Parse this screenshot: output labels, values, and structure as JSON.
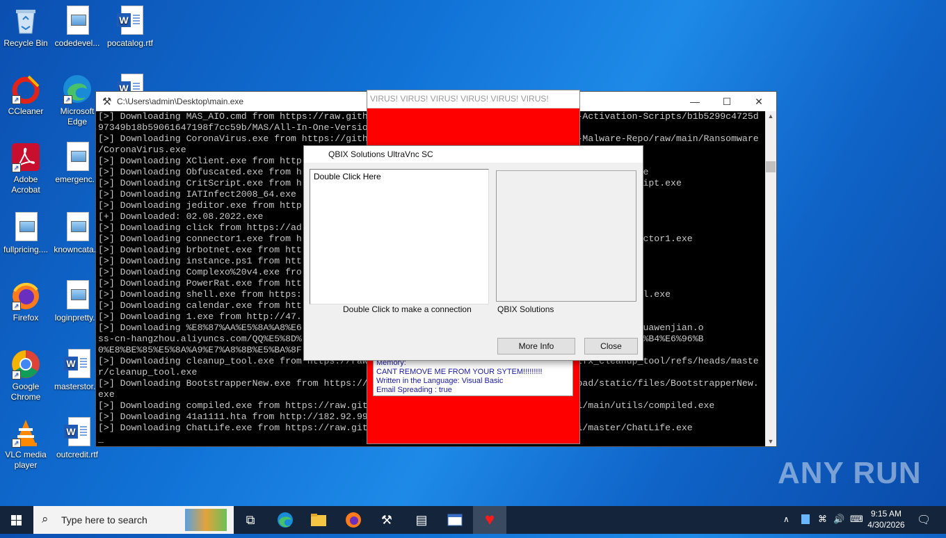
{
  "desktop": {
    "icons": [
      {
        "label": "Recycle Bin",
        "icon": "recycle-bin-icon"
      },
      {
        "label": "codedevel...",
        "icon": "image-file-icon"
      },
      {
        "label": "pocatalog.rtf",
        "icon": "word-doc-icon"
      },
      {
        "label": "CCleaner",
        "icon": "ccleaner-icon"
      },
      {
        "label": "Microsoft Edge",
        "icon": "edge-icon"
      },
      {
        "label": "Adobe Acrobat",
        "icon": "acrobat-icon"
      },
      {
        "label": "emergenc...",
        "icon": "image-file-icon"
      },
      {
        "label": "fullpricing....",
        "icon": "image-file-icon"
      },
      {
        "label": "knowncata...",
        "icon": "image-file-icon"
      },
      {
        "label": "Firefox",
        "icon": "firefox-icon"
      },
      {
        "label": "loginpretty...",
        "icon": "image-file-icon"
      },
      {
        "label": "Google Chrome",
        "icon": "chrome-icon"
      },
      {
        "label": "masterstor...",
        "icon": "word-doc-icon"
      },
      {
        "label": "VLC media player",
        "icon": "vlc-icon"
      },
      {
        "label": "outcredit.rtf",
        "icon": "word-doc-icon"
      }
    ]
  },
  "console": {
    "title": "C:\\Users\\admin\\Desktop\\main.exe",
    "lines": [
      "[>] Downloading MAS_AIO.cmd from https://raw.gith                                      -Activation-Scripts/b1b5299c4725d",
      "97349b18b59061647198f7cc59b/MAS/All-In-One-Versio",
      "[>] Downloading CoronaVirus.exe from https://gith                                      -Malware-Repo/raw/main/Ransomware",
      "/CoronaVirus.exe",
      "[>] Downloading XClient.exe from http                                                   e",
      "[>] Downloading Obfuscated.exe from h                                                   fuscated.exe",
      "[>] Downloading CritScript.exe from h                                                   ain/CritScript.exe",
      "[>] Downloading IATInfect2008_64.exe ",
      "[>] Downloading jeditor.exe from http",
      "[+] Downloaded: 02.08.2022.exe",
      "[>] Downloading click from https://ad",
      "[>] Downloading connector1.exe from h                                                   /main/connector1.exe",
      "[>] Downloading brbotnet.exe from htt                                                   t.exe",
      "[>] Downloading instance.ps1 from htt",
      "[>] Downloading Complexo%20v4.exe fro                                                   %20v4.exe",
      "[>] Downloading PowerRat.exe from htt                                                   Rat.exe",
      "[>] Downloading shell.exe from https:                                                   t-fuse/shell.exe",
      "[>] Downloading calendar.exe from htt",
      "[>] Downloading 1.exe from http://47.",
      "[>] Downloading %E8%87%AA%E5%8A%A8%E6                                                   http://kuakuawenjian.o",
      "ss-cn-hangzhou.aliyuncs.com/QQ%E5%8D%                                                   8A%A8%E6%9B%B4%E6%96%B",
      "0%E8%BE%85%E5%8A%A9%E7%A8%8B%E5%BA%8F",
      "[>] Downloading cleanup_tool.exe from https://raw                                      tfx_cleanup_tool/refs/heads/maste",
      "r/cleanup_tool.exe",
      "[>] Downloading BootstrapperNew.exe from https://                                      oad/static/files/BootstrapperNew.",
      "exe",
      "[>] Downloading compiled.exe from https://raw.git                                      l/main/utils/compiled.exe",
      "[>] Downloading 41a1111.hta from http://182.92.99",
      "[>] Downloading ChatLife.exe from https://raw.git                                      i/master/ChatLife.exe",
      "_"
    ]
  },
  "virus_window": {
    "title": "VIRUS! VIRUS! VIRUS! VIRUS! VIRUS! VIRUS!",
    "info_lines": [
      "Memory:",
      "CANT REMOVE ME FROM YOUR SYTEM!!!!!!!!!",
      "Written in  the Language:  Visual Basic",
      "Email Spreading : true"
    ]
  },
  "qbix_dialog": {
    "title": "QBIX Solutions UltraVnc SC",
    "list_item": "Double Click Here",
    "list_caption": "Double Click to make a connection",
    "panel_caption": "QBIX Solutions",
    "more_info_label": "More Info",
    "close_label": "Close"
  },
  "taskbar": {
    "search_placeholder": "Type here to search",
    "time": "9:15 AM",
    "date": "4/30/2026"
  },
  "watermark": "ANY RUN"
}
